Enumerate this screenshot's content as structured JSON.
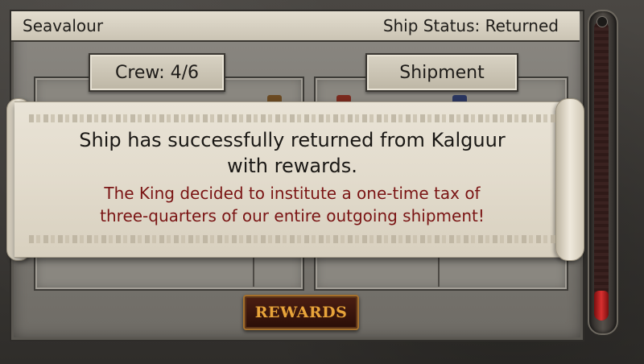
{
  "header": {
    "ship_name": "Seavalour",
    "ship_status": "Ship Status: Returned"
  },
  "crew_tag": "Crew: 4/6",
  "shipment_tag": "Shipment",
  "message": {
    "line1": "Ship has successfully returned from Kalguur",
    "line2": "with rewards.",
    "tax_line1": "The King decided to institute a one-time tax of",
    "tax_line2": "three-quarters of our entire outgoing shipment!"
  },
  "rewards_button": "REWARDS",
  "meter": {
    "fill_fraction": 0.1
  },
  "colors": {
    "tax_text": "#7a1414",
    "button_text": "#e8a43a",
    "meter_fill": "#d83030"
  }
}
